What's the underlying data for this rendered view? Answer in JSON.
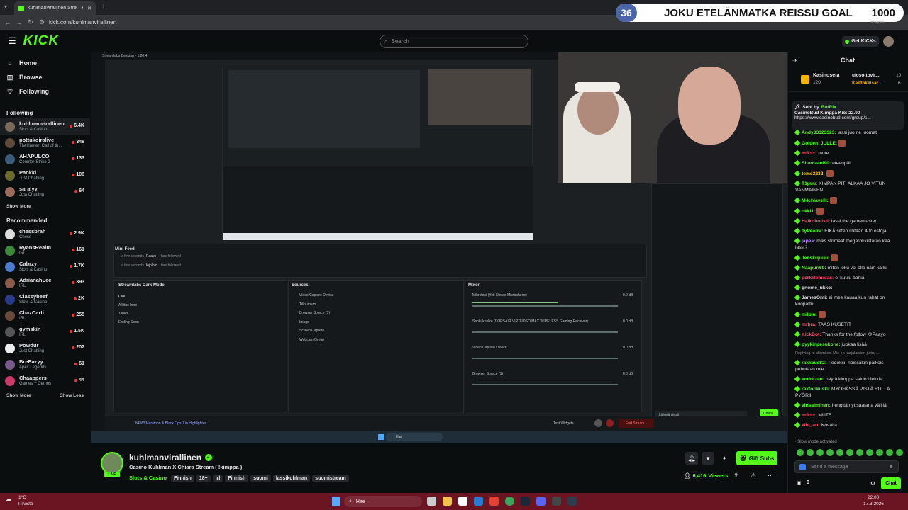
{
  "browser": {
    "tab_title": "kuhlmanvirallinen Stream",
    "url": "kick.com/kuhlmanvirallinen",
    "profile_label": "Incognito"
  },
  "goal": {
    "count": "36",
    "title": "JOKU ETELÄNMATKA REISSU GOAL",
    "target": "1000"
  },
  "header": {
    "logo": "KICK",
    "search_placeholder": "Search",
    "get_kicks": "Get KICKs"
  },
  "nav": {
    "home": "Home",
    "browse": "Browse",
    "following": "Following"
  },
  "following": {
    "title": "Following",
    "items": [
      {
        "name": "kuhlmanvirallinen",
        "category": "Slots & Casino",
        "viewers": "6.4K",
        "color": "#7a6a5c"
      },
      {
        "name": "pottukoiralive",
        "category": "TheHunter: Call of th...",
        "viewers": "348",
        "color": "#5c4a3a"
      },
      {
        "name": "AHAPULCO",
        "category": "Counter-Strike 2",
        "viewers": "133",
        "color": "#3a5c7a"
      },
      {
        "name": "Pankki",
        "category": "Just Chatting",
        "viewers": "106",
        "color": "#6a6a2a"
      },
      {
        "name": "saralyy",
        "category": "Just Chatting",
        "viewers": "64",
        "color": "#9a6a5a"
      }
    ],
    "show_more": "Show More"
  },
  "recommended": {
    "title": "Recommended",
    "items": [
      {
        "name": "chessbrah",
        "category": "Chess",
        "viewers": "2.9K",
        "color": "#ddd"
      },
      {
        "name": "RyansRealm",
        "category": "IRL",
        "viewers": "161",
        "color": "#3a8a3a"
      },
      {
        "name": "Cabrzy",
        "category": "Slots & Casino",
        "viewers": "1.7K",
        "color": "#4a7acc"
      },
      {
        "name": "AdrianahLee",
        "category": "IRL",
        "viewers": "393",
        "color": "#8a5a4a"
      },
      {
        "name": "Classybeef",
        "category": "Slots & Casino",
        "viewers": "2K",
        "color": "#2a3a8a"
      },
      {
        "name": "ChazCarti",
        "category": "IRL",
        "viewers": "255",
        "color": "#6a4a3a"
      },
      {
        "name": "gymskin",
        "category": "IRL",
        "viewers": "1.5K",
        "color": "#555"
      },
      {
        "name": "Powdur",
        "category": "Just Chatting",
        "viewers": "202",
        "color": "#eee"
      },
      {
        "name": "BreEazyy",
        "category": "Apex Legends",
        "viewers": "61",
        "color": "#7a5a8a"
      },
      {
        "name": "Chaappers",
        "category": "Games + Demos",
        "viewers": "44",
        "color": "#cc3a6a"
      }
    ],
    "show_more": "Show More",
    "show_less": "Show Less"
  },
  "obs": {
    "window_title": "Streamlabs Desktop - 1.20.4",
    "mini_feed_title": "Mini Feed",
    "feed": [
      {
        "time": "a few seconds",
        "user": "Paayo",
        "action": "has followed"
      },
      {
        "time": "a few seconds",
        "user": "lojololo",
        "action": "has followed"
      }
    ],
    "scenes_title": "Streamlabs Dark Mode",
    "scenes": [
      "Live",
      "Alkitus Intro",
      "Tauko",
      "Ending Soon"
    ],
    "sources_title": "Sources",
    "sources": [
      "Video Capture Device",
      "Tilinumero",
      "Browser Source (1)",
      "Image",
      "Screen Capture",
      "Webcam Group"
    ],
    "mixer_title": "Mixer",
    "mixer": [
      {
        "name": "Mikrofoni (Yeti Stereo Microphone)",
        "db": "0.0 dB"
      },
      {
        "name": "Sankukuulke (CORSAIR VIRTUOSO MAX WIRELESS Gaming Receiver)",
        "db": "0.0 dB"
      },
      {
        "name": "Video Capture Device",
        "db": "0.0 dB"
      },
      {
        "name": "Browser Source (1)",
        "db": "0.0 dB"
      }
    ],
    "bottom_banner": "NEW! Marathon & Black Ops 7 in Highlighter",
    "test_widgets": "Test Widgets",
    "end_stream": "End Stream",
    "vchat_placeholder": "Lähetä viesti",
    "vchat_btn": "Chatti",
    "inner_search": "Hae"
  },
  "stream": {
    "channel": "kuhlmanvirallinen",
    "title": "Casino Kuhlman X Chiara Stream ( !kimppa )",
    "category": "Slots & Casino",
    "tags": [
      "Finnish",
      "18+",
      "irl",
      "Finnish",
      "suomi",
      "lassikuhlman",
      "suomistream"
    ],
    "viewers": "6,416",
    "viewers_label": "Viewers",
    "gift_subs": "Gift Subs",
    "live_badge": "LIVE"
  },
  "chat": {
    "title": "Chat",
    "leaderboard": [
      {
        "name": "Kasinoseta",
        "amount": "120"
      },
      {
        "name": "uiosottovir...",
        "amount": "10"
      },
      {
        "name": "Keittokeisar...",
        "amount": "6"
      }
    ],
    "pinned": {
      "sent_by_label": "Sent by",
      "sender": "BotRix",
      "text": "CasinoBud Kimppa Kio: 22.00",
      "link": "https://www.casinobud.com/group/s..."
    },
    "messages": [
      {
        "user": "Andy33323323:",
        "text": "lassi juo ne juomat",
        "color": "#53fc18"
      },
      {
        "user": "Golden_JULLE:",
        "text": "",
        "color": "#53fc18",
        "emote": true
      },
      {
        "user": "mfksx:",
        "text": "mute",
        "color": "#ff4d6a"
      },
      {
        "user": "Shamaani90:",
        "text": "eteenpäi",
        "color": "#53fc18"
      },
      {
        "user": "teme3232:",
        "text": "",
        "color": "#ffcc33",
        "emote": true
      },
      {
        "user": "T1puu:",
        "text": "KIMPAN PITI ALKAA JO VITUN VANMAINEN",
        "color": "#53fc18"
      },
      {
        "user": "M4chiavelli:",
        "text": "",
        "color": "#53fc18",
        "emote": true
      },
      {
        "user": "okki1:",
        "text": "",
        "color": "#53fc18",
        "emote": true
      },
      {
        "user": "Halkoholisti:",
        "text": "lassi the gamemaster",
        "color": "#ff4d6a"
      },
      {
        "user": "TyPearra:",
        "text": "EIKÄ sitten mitään 40c ostoja",
        "color": "#53fc18"
      },
      {
        "user": "japea:",
        "text": "miks strimaat megarokkistaran kaa lassi?",
        "color": "#b58cff"
      },
      {
        "user": "Jenskujuuu:",
        "text": "",
        "color": "#53fc18",
        "emote": true
      },
      {
        "user": "Naapuri69:",
        "text": "miten joku voi olla näin kallu",
        "color": "#53fc18"
      },
      {
        "user": "perkelemaras:",
        "text": "ei kuulu äänia",
        "color": "#ff4d6a"
      },
      {
        "user": "gnome_ukko:",
        "text": "",
        "color": "#dddddd"
      },
      {
        "user": "JamesOnti:",
        "text": "ei mee kauaa kun rahat on kuopattu",
        "color": "#dddddd"
      },
      {
        "user": "milbiu:",
        "text": "",
        "color": "#53fc18",
        "emote": true
      },
      {
        "user": "mrbra:",
        "text": "TAAS KUSETIT",
        "color": "#ff4d6a"
      },
      {
        "user": "KickBot:",
        "text": "Thanks for the follow @Paayo",
        "color": "#ff4d6a"
      },
      {
        "user": "pyykinpesukone:",
        "text": "juokaa lisää",
        "color": "#53fc18"
      },
      {
        "user": "rakkaus82:",
        "text": "Tiedoksi, noissakin paikois puhutaan mie",
        "color": "#53fc18"
      },
      {
        "user": "endorzan:",
        "text": "näytä kimppa saldo hiekkis",
        "color": "#53fc18"
      },
      {
        "user": "raktorikuski:",
        "text": "MYÖHÄSSÄ PISTÄ RULLA PYÖRII",
        "color": "#53fc18"
      },
      {
        "user": "vinsalminen:",
        "text": "hengitä nyt saatana välillä",
        "color": "#53fc18"
      },
      {
        "user": "mfksx:",
        "text": "MUTE",
        "color": "#ff4d6a"
      },
      {
        "user": "ello_art:",
        "text": "Kovalla",
        "color": "#ff4d6a"
      }
    ],
    "reply_preview": "Replying to allsmiles: Mie on karjalaisten juttu, ...",
    "slow_mode": "Slow mode activated",
    "input_placeholder": "Send a message",
    "points": "0",
    "chat_button": "Chat"
  },
  "taskbar": {
    "weather_temp": "1°C",
    "weather_desc": "Pilvistä",
    "search": "Hae",
    "time": "22.00",
    "date": "17.3.2026"
  }
}
